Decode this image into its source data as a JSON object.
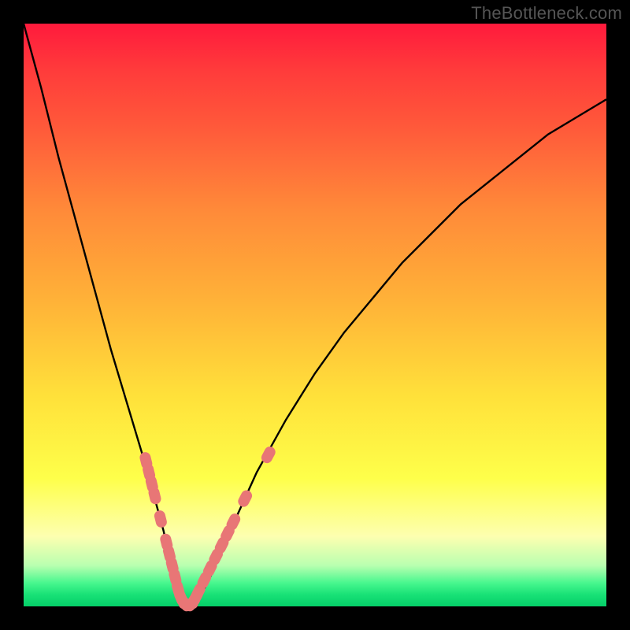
{
  "watermark": "TheBottleneck.com",
  "colors": {
    "background": "#000000",
    "gradient_top": "#ff1a3c",
    "gradient_bottom": "#05cf69",
    "curve": "#000000",
    "markers": "#e87676"
  },
  "chart_data": {
    "type": "line",
    "title": "",
    "xlabel": "",
    "ylabel": "",
    "xlim": [
      0,
      100
    ],
    "ylim": [
      0,
      100
    ],
    "grid": false,
    "legend": false,
    "series": [
      {
        "name": "bottleneck-curve",
        "x": [
          0,
          3,
          6,
          9,
          12,
          15,
          18,
          21,
          24,
          26,
          27,
          28,
          29,
          30,
          32,
          35,
          40,
          45,
          50,
          55,
          60,
          65,
          70,
          75,
          80,
          85,
          90,
          95,
          100
        ],
        "y": [
          100,
          89,
          77,
          66,
          55,
          44,
          34,
          24,
          13,
          4,
          1,
          0,
          0,
          1,
          5,
          12,
          23,
          32,
          40,
          47,
          53,
          59,
          64,
          69,
          73,
          77,
          81,
          84,
          87
        ]
      }
    ],
    "markers": [
      {
        "x": 21.0,
        "y": 25.0
      },
      {
        "x": 21.5,
        "y": 23.0
      },
      {
        "x": 22.0,
        "y": 21.0
      },
      {
        "x": 22.5,
        "y": 19.0
      },
      {
        "x": 23.5,
        "y": 15.0
      },
      {
        "x": 24.5,
        "y": 11.0
      },
      {
        "x": 25.0,
        "y": 9.0
      },
      {
        "x": 25.5,
        "y": 7.0
      },
      {
        "x": 26.0,
        "y": 5.0
      },
      {
        "x": 26.5,
        "y": 3.0
      },
      {
        "x": 27.0,
        "y": 1.5
      },
      {
        "x": 27.5,
        "y": 0.7
      },
      {
        "x": 28.0,
        "y": 0.3
      },
      {
        "x": 28.5,
        "y": 0.3
      },
      {
        "x": 29.0,
        "y": 0.7
      },
      {
        "x": 29.5,
        "y": 1.5
      },
      {
        "x": 30.0,
        "y": 2.5
      },
      {
        "x": 31.0,
        "y": 4.5
      },
      {
        "x": 32.0,
        "y": 6.5
      },
      {
        "x": 33.0,
        "y": 8.5
      },
      {
        "x": 34.0,
        "y": 10.5
      },
      {
        "x": 35.0,
        "y": 12.5
      },
      {
        "x": 36.0,
        "y": 14.5
      },
      {
        "x": 38.0,
        "y": 18.5
      },
      {
        "x": 42.0,
        "y": 26.0
      }
    ]
  }
}
